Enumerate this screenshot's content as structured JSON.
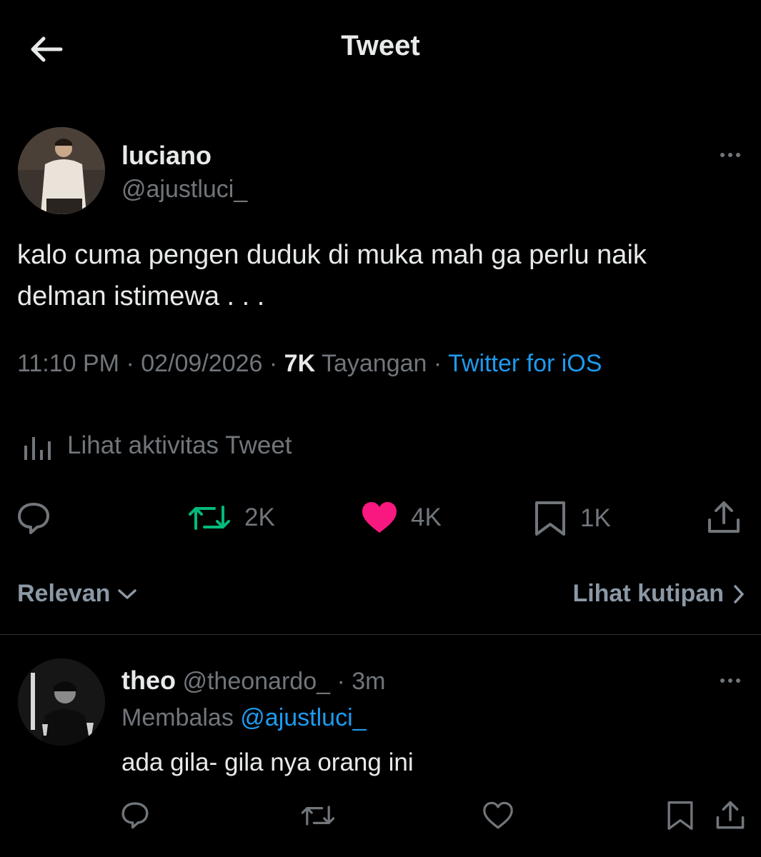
{
  "header": {
    "title": "Tweet"
  },
  "tweet": {
    "author_name": "luciano",
    "author_handle": "@ajustluci_",
    "text_line1": "kalo cuma pengen duduk di muka mah ga perlu naik",
    "text_line2": "delman istimewa . . .",
    "time": "11:10 PM",
    "date": "02/09/2026",
    "views_count": "7K",
    "views_label": "Tayangan",
    "source": "Twitter for iOS",
    "sep": "·",
    "activity_label": "Lihat aktivitas Tweet",
    "retweets": "2K",
    "likes": "4K",
    "bookmarks": "1K"
  },
  "sort": {
    "left_label": "Relevan",
    "right_label": "Lihat kutipan"
  },
  "reply": {
    "author_name": "theo",
    "author_handle": "@theonardo_",
    "time": "3m",
    "replying_label": "Membalas",
    "replying_to": "@ajustluci_",
    "text": "ada gila- gila nya orang ini"
  },
  "colors": {
    "background": "#000000",
    "accent": "#1d9bf0",
    "retweet_green": "#00ba7c",
    "like_pink": "#f91880",
    "muted": "#71767b"
  }
}
